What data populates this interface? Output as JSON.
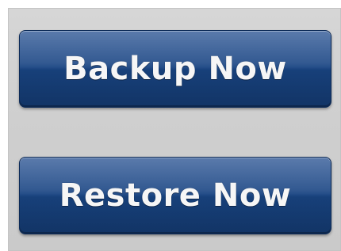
{
  "buttons": {
    "backup_label": "Backup Now",
    "restore_label": "Restore Now"
  },
  "colors": {
    "button_blue": "#1d4580",
    "button_text": "#f6f6f6",
    "panel_gray": "#cfcfcf"
  }
}
